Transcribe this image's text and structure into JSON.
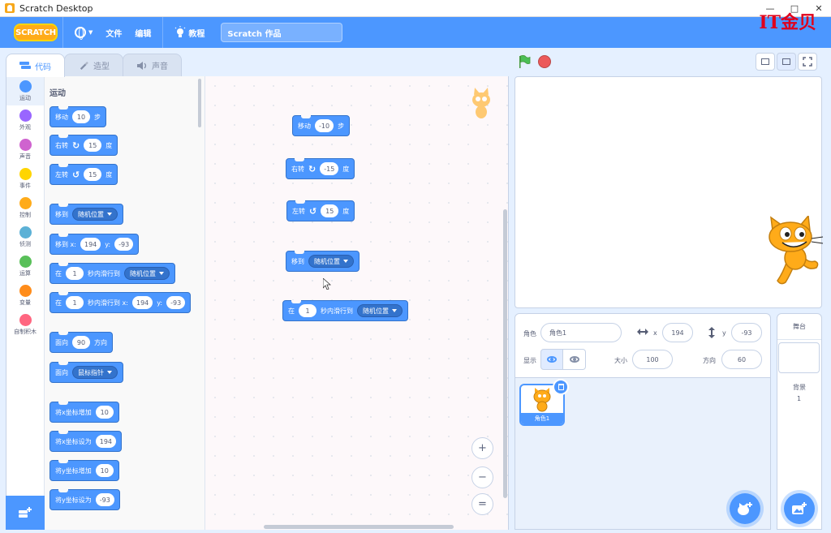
{
  "window": {
    "title": "Scratch Desktop",
    "minimize": "—",
    "maximize": "□",
    "close": "✕"
  },
  "menu": {
    "logo": "SCRATCH",
    "file": "文件",
    "edit": "编辑",
    "tutorials": "教程",
    "project_title": "Scratch 作品",
    "watermark": "IT金贝"
  },
  "tabs": [
    {
      "label": "代码"
    },
    {
      "label": "造型"
    },
    {
      "label": "声音"
    }
  ],
  "categories": [
    {
      "label": "运动",
      "color": "#4c97ff"
    },
    {
      "label": "外观",
      "color": "#9966ff"
    },
    {
      "label": "声音",
      "color": "#cf63cf"
    },
    {
      "label": "事件",
      "color": "#ffd500"
    },
    {
      "label": "控制",
      "color": "#ffab19"
    },
    {
      "label": "侦测",
      "color": "#5cb1d6"
    },
    {
      "label": "运算",
      "color": "#59c059"
    },
    {
      "label": "变量",
      "color": "#ff8c1a"
    },
    {
      "label": "自制积木",
      "color": "#ff6680"
    }
  ],
  "palette": {
    "title": "运动",
    "move": {
      "a": "移动",
      "v": "10",
      "b": "步"
    },
    "turn_right": {
      "a": "右转",
      "icon": "↻",
      "v": "15",
      "b": "度"
    },
    "turn_left": {
      "a": "左转",
      "icon": "↺",
      "v": "15",
      "b": "度"
    },
    "goto": {
      "a": "移到",
      "d": "随机位置"
    },
    "goto_xy": {
      "a": "移到 x:",
      "x": "194",
      "b": "y:",
      "y": "-93"
    },
    "glide": {
      "a": "在",
      "v": "1",
      "b": "秒内滑行到",
      "d": "随机位置"
    },
    "glide_xy": {
      "a": "在",
      "v": "1",
      "b": "秒内滑行到 x:",
      "x": "194",
      "c": "y:",
      "y": "-93"
    },
    "point_dir": {
      "a": "面向",
      "v": "90",
      "b": "方向"
    },
    "point_towards": {
      "a": "面向",
      "d": "鼠标指针"
    },
    "change_x": {
      "a": "将x坐标增加",
      "v": "10"
    },
    "set_x": {
      "a": "将x坐标设为",
      "v": "194"
    },
    "change_y": {
      "a": "将y坐标增加",
      "v": "10"
    },
    "set_y": {
      "a": "将y坐标设为",
      "v": "-93"
    }
  },
  "workspace": {
    "move": {
      "a": "移动",
      "v": "-10",
      "b": "步"
    },
    "turn_right": {
      "a": "右转",
      "icon": "↻",
      "v": "-15",
      "b": "度"
    },
    "turn_left": {
      "a": "左转",
      "icon": "↺",
      "v": "15",
      "b": "度"
    },
    "goto": {
      "a": "移到",
      "d": "随机位置"
    },
    "glide": {
      "a": "在",
      "v": "1",
      "b": "秒内滑行到",
      "d": "随机位置"
    },
    "zoom_in": "+",
    "zoom_out": "−",
    "zoom_reset": "="
  },
  "sprite_info": {
    "sprite_label": "角色",
    "sprite_name": "角色1",
    "x_label": "x",
    "x": "194",
    "y_label": "y",
    "y": "-93",
    "show_label": "显示",
    "size_label": "大小",
    "size": "100",
    "direction_label": "方向",
    "direction": "60"
  },
  "sprites": [
    {
      "name": "角色1"
    }
  ],
  "stage_panel": {
    "title": "舞台",
    "backdrops_label": "背景",
    "backdrops_count": "1"
  }
}
